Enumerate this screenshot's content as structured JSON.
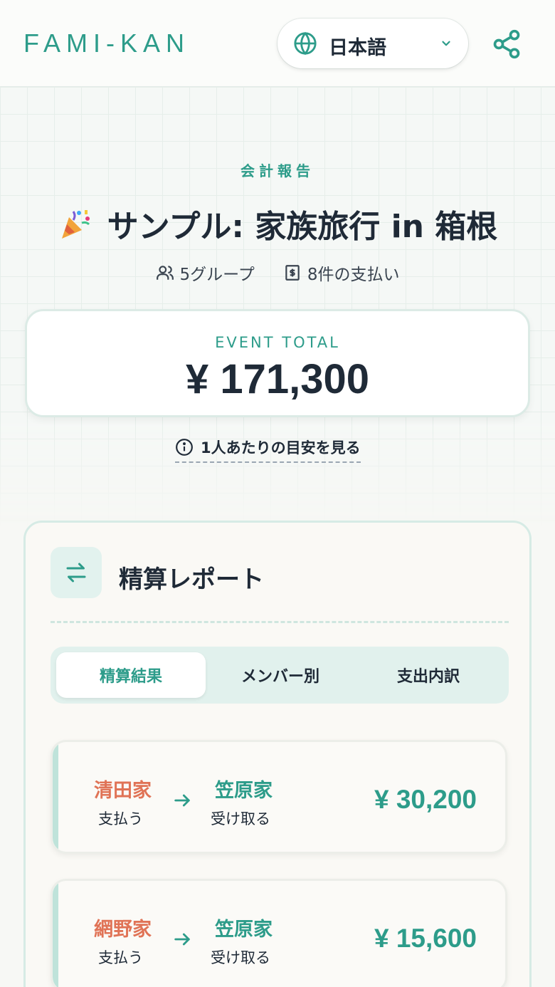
{
  "header": {
    "logo": "FAMI-KAN",
    "language": "日本語"
  },
  "event": {
    "section_label": "会計報告",
    "title": "サンプル: 家族旅行 in 箱根",
    "groups": "5グループ",
    "payments": "8件の支払い"
  },
  "total": {
    "label": "EVENT TOTAL",
    "amount": "¥ 171,300"
  },
  "per_person_link": "1人あたりの目安を見る",
  "report": {
    "title": "精算レポート",
    "tabs": [
      {
        "label": "精算結果",
        "active": true
      },
      {
        "label": "メンバー別",
        "active": false
      },
      {
        "label": "支出内訳",
        "active": false
      }
    ],
    "transfers": [
      {
        "payer": "清田家",
        "payer_role": "支払う",
        "payee": "笠原家",
        "payee_role": "受け取る",
        "amount": "¥ 30,200"
      },
      {
        "payer": "網野家",
        "payer_role": "支払う",
        "payee": "笠原家",
        "payee_role": "受け取る",
        "amount": "¥ 15,600"
      }
    ]
  },
  "colors": {
    "accent": "#2d9c8a",
    "payer": "#e07356",
    "text": "#1f2a37"
  }
}
